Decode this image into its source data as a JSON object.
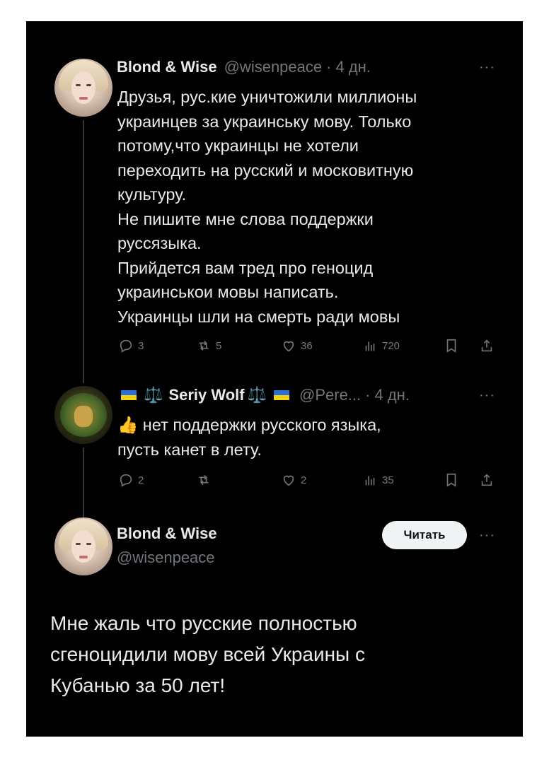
{
  "tweet1": {
    "name": "Blond & Wise",
    "handle": "@wisenpeace",
    "sep": "·",
    "time": "4 дн.",
    "more": "···",
    "text": "Друзья, рус.кие уничтожили миллионы\nукраинцев за украинську мову. Только\nпотому,что украинцы не хотели\nпереходить на русский и московитную\nкультуру.\nНе пишите мне слова поддержки\nруссязыка.\nПрийдется вам тред про геноцид\nукраинськои мовы написать.\nУкраинцы шли на смерть ради мовы",
    "actions": {
      "replies": "3",
      "reposts": "5",
      "likes": "36",
      "views": "720"
    }
  },
  "tweet2": {
    "scale_icon": "⚖️",
    "name": "Seriy Wolf",
    "handle": "@Pere...",
    "sep": "·",
    "time": "4 дн.",
    "more": "···",
    "emoji": "👍",
    "text": "нет поддержки русского языка,\nпусть канет в лету.",
    "actions": {
      "replies": "2",
      "reposts": "",
      "likes": "2",
      "views": "35"
    }
  },
  "tweet3": {
    "name": "Blond & Wise",
    "handle": "@wisenpeace",
    "follow_label": "Читать",
    "more": "···",
    "text": "Мне жаль что русские полностью\nсгеноцидили мову всей Украины с\nКубанью за 50 лет!"
  },
  "icons": [
    "reply-icon",
    "repost-icon",
    "like-icon",
    "views-icon",
    "bookmark-icon",
    "share-icon"
  ],
  "colors": {
    "background": "#000000",
    "text": "#e7e9ea",
    "muted": "#71767b",
    "button": "#eff3f4"
  }
}
